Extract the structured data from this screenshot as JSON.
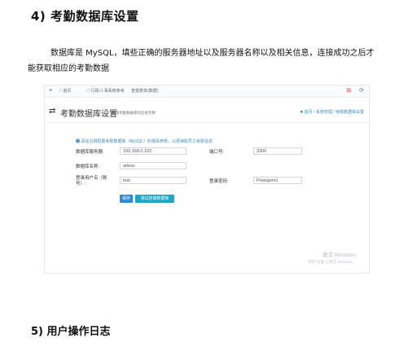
{
  "doc": {
    "heading4": "4)  考勤数据库设置",
    "paragraph_line1": "数据库是 MySQL，填些正确的服务器地址以及服务器名称以及相关信息，连接成功之后才",
    "paragraph_line2": "能获取相应的考勤数据",
    "heading5": "5)  用户操作日志"
  },
  "app": {
    "menu_icon": "≡",
    "tabs": [
      "◁ 首页",
      "◁ 行政/人事系统参考",
      "查报表单(数据)"
    ],
    "top_icons": [
      "⊠",
      "⟳"
    ],
    "page_icon": "⇄",
    "page_title": "考勤数据库设置",
    "page_subtitle": "管理考勤数据库的连接参数",
    "breadcrumb": "✱ 首页 / 系统管理 / 考勤数据库设置",
    "tip": "❶ 请在右侧配置考勤数据库（MySQL）的相关参数，以便读取员工考勤信息",
    "form": {
      "server_label": "数据库服务器:",
      "server_value": "192.168.0.102",
      "port_label": "端口号:",
      "port_value": "3306",
      "dbname_label": "数据库名称:",
      "dbname_value": "attess",
      "user_label": "登录用户名（账号）:",
      "user_value": "test",
      "password_label": "登录密码:",
      "password_value": "Poangom1"
    },
    "save_label": "保存",
    "test_label": "测试连接数据库",
    "watermark_line1": "激活 Windows",
    "watermark_line2": "转到\"设置\"以激活 Windows。"
  }
}
